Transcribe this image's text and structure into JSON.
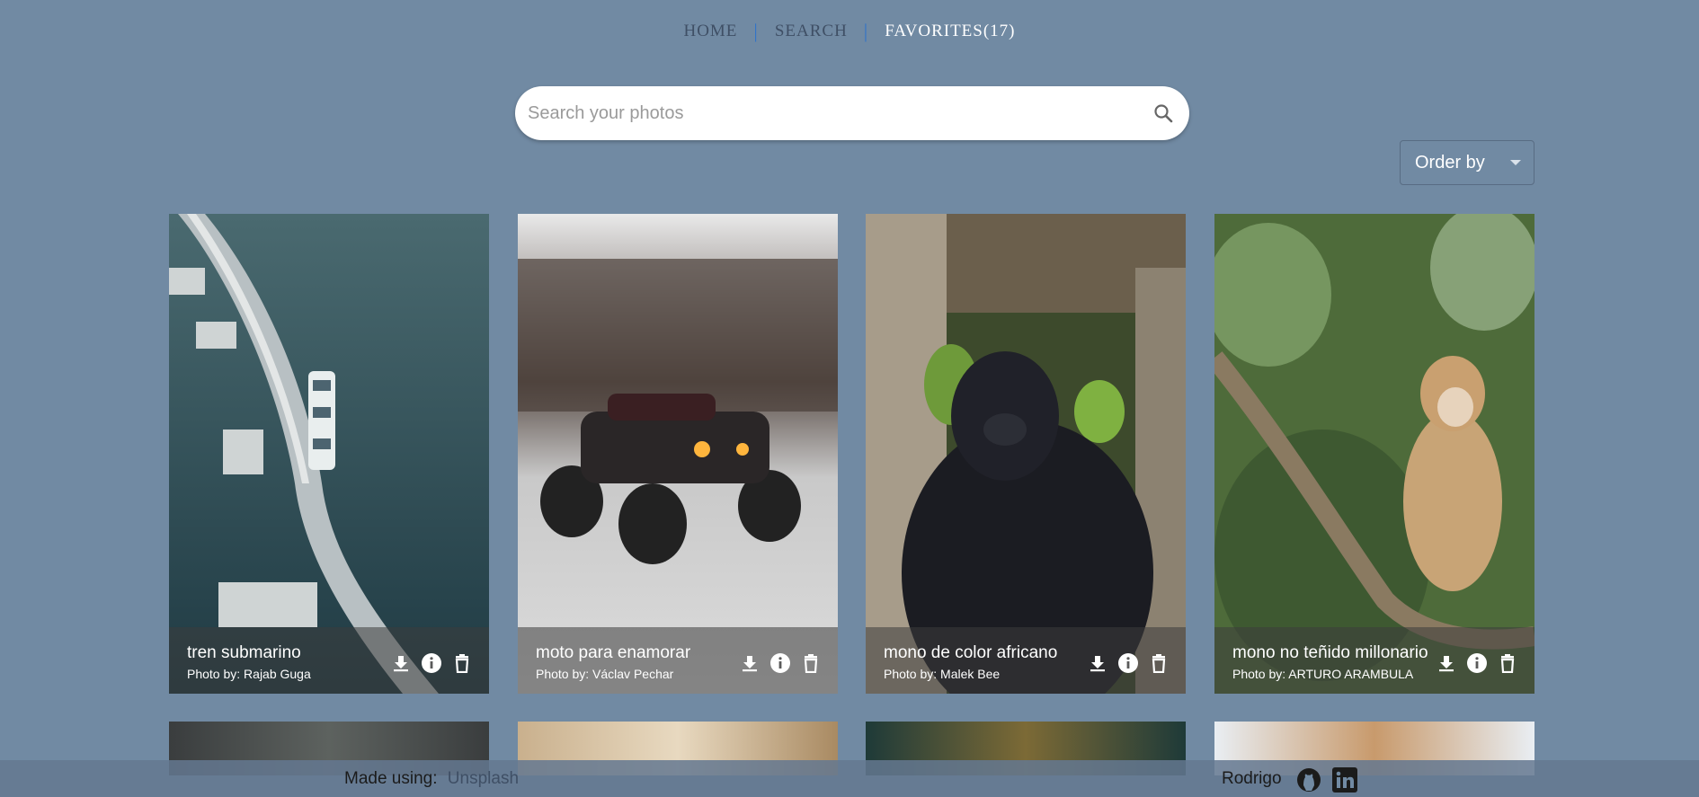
{
  "nav": {
    "home": "HOME",
    "search": "SEARCH",
    "favorites": "FAVORITES(17)",
    "separator": "|"
  },
  "search": {
    "placeholder": "Search your photos",
    "icon": "search-icon"
  },
  "order_by": {
    "label": "Order by"
  },
  "cards": [
    {
      "title": "tren submarino",
      "author": "Photo by: Rajab Guga"
    },
    {
      "title": "moto para enamorar",
      "author": "Photo by: Václav Pechar"
    },
    {
      "title": "mono de color africano",
      "author": "Photo by: Malek Bee"
    },
    {
      "title": "mono no teñido millonario",
      "author": "Photo by: ARTURO ARAMBULA"
    }
  ],
  "card_actions": [
    "download-icon",
    "info-icon",
    "delete-icon"
  ],
  "footer": {
    "made_using": "Made using:",
    "source": "Unsplash",
    "owner": "Rodrigo",
    "icons": [
      "github-icon",
      "linkedin-icon"
    ]
  },
  "colors": {
    "background": "#718aa3",
    "nav_inactive": "#3f4f65",
    "nav_active": "#ffffff",
    "nav_separator": "#2f73c9"
  }
}
